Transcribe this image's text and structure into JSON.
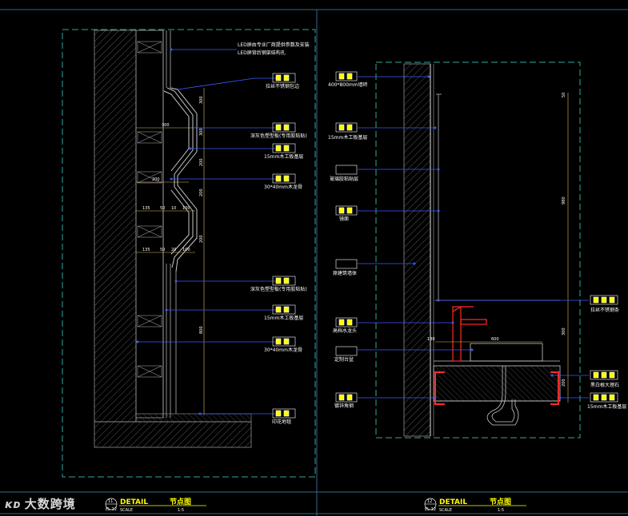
{
  "left_callouts": [
    {
      "text": "LED屏由专业厂商提供参数及安装"
    },
    {
      "text": "LED屏背后钢架结构孔"
    },
    {
      "text": "拉丝不锈钢包边"
    },
    {
      "text": "深灰色塑型板(专用胶粘贴)"
    },
    {
      "text": "15mm木工板基层"
    },
    {
      "text": "30*40mm木龙骨"
    },
    {
      "text": "深灰色塑型板(专用胶粘贴)"
    },
    {
      "text": "15mm木工板基层"
    },
    {
      "text": "30*40mm木龙骨"
    },
    {
      "text": "印花地毯"
    }
  ],
  "right_callouts": [
    {
      "text": "400*800mm墙砖"
    },
    {
      "text": "15mm木工板基层"
    },
    {
      "text": "玻璃胶粘贴层"
    },
    {
      "text": "镜面"
    },
    {
      "text": "原建筑墙体"
    },
    {
      "text": "高档水龙头"
    },
    {
      "text": "定制台盆"
    },
    {
      "text": "镀锌角钢"
    }
  ],
  "right_side_callouts": [
    {
      "text": "拉丝不锈钢条"
    },
    {
      "text": "黑白根大理石"
    },
    {
      "text": "15mm木工板基层"
    }
  ],
  "left_dims": [
    "300",
    "200",
    "135",
    "50",
    "10",
    "100",
    "135",
    "50",
    "20",
    "100",
    "300",
    "300",
    "200",
    "200",
    "200",
    "800"
  ],
  "right_dims": [
    "980",
    "600",
    "180",
    "300",
    "200",
    "50"
  ],
  "titles": [
    {
      "number": "11",
      "ref": "EL-12",
      "label": "DETAIL",
      "name": "节点图",
      "scale_label": "SCALE",
      "scale": "1:5"
    },
    {
      "number": "12",
      "ref": "EL-12",
      "label": "DETAIL",
      "name": "节点图",
      "scale_label": "SCALE",
      "scale": "1:5"
    }
  ],
  "watermark": {
    "logo": "ᴋᴅ",
    "text": "大数跨境"
  },
  "colors": {
    "background": "#000000",
    "leader": "#3a5bff",
    "frame": "#2fa89a",
    "wall": "#8f8f8f",
    "dim": "#d8c25a",
    "tag": "#ffff00",
    "faucet": "#ff2a2a"
  }
}
